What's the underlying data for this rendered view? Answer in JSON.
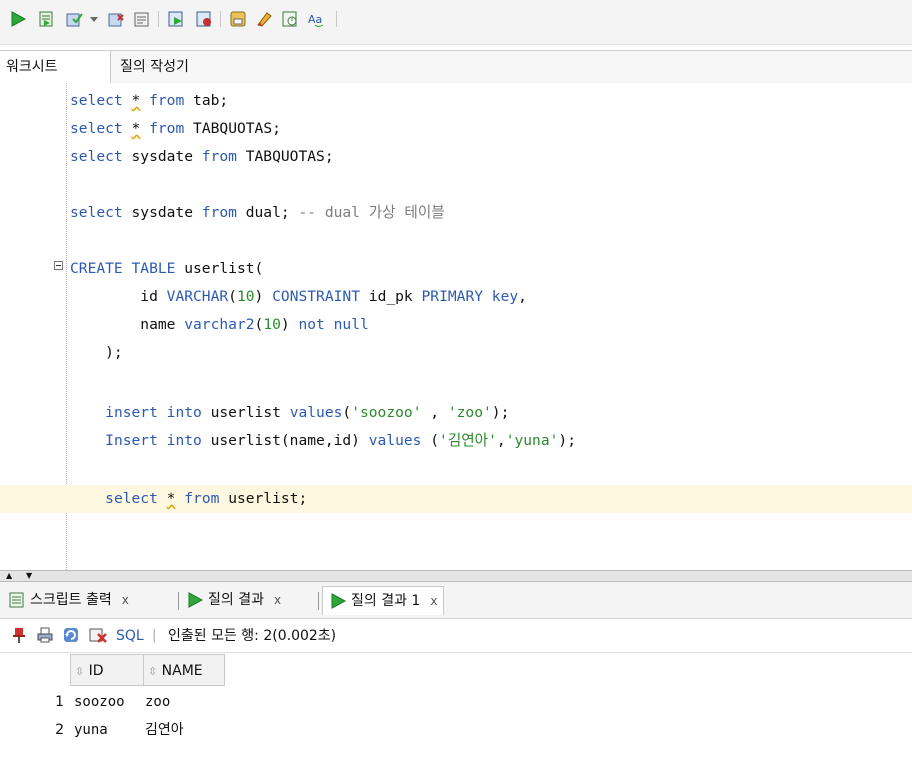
{
  "toolbar": {
    "icons": [
      "run-statement-icon",
      "run-script-icon",
      "commit-icon",
      "dropdown-icon",
      "rollback-icon",
      "explain-plan-icon",
      "autotrace-icon",
      "sql-tuning-icon",
      "clear-icon",
      "history-icon",
      "unshared-sql-icon",
      "format-icon"
    ]
  },
  "editor_tabs": [
    "워크시트",
    "질의 작성기"
  ],
  "code_lines": [
    {
      "text": "select * from tab;"
    },
    {
      "text": "select * from TABQUOTAS;"
    },
    {
      "text": "select sysdate from TABQUOTAS;"
    },
    {
      "text": ""
    },
    {
      "text": "select sysdate from dual; -- dual 가상 테이블"
    },
    {
      "text": ""
    },
    {
      "text": "CREATE TABLE userlist("
    },
    {
      "text": "        id VARCHAR(10) CONSTRAINT id_pk PRIMARY key,"
    },
    {
      "text": "        name varchar2(10) not null"
    },
    {
      "text": "    );"
    },
    {
      "text": ""
    },
    {
      "text": "    insert into userlist values('soozoo' , 'zoo');"
    },
    {
      "text": "    Insert into userlist(name,id) values ('김연아','yuna');"
    },
    {
      "text": ""
    },
    {
      "text": "    select * from userlist;"
    }
  ],
  "result_tabs": [
    {
      "label": "스크립트 출력",
      "close": "x",
      "icon": "script-output-icon"
    },
    {
      "label": "질의 결과",
      "close": "x",
      "icon": "query-result-icon"
    },
    {
      "label": "질의 결과 1",
      "close": "x",
      "icon": "query-result-icon"
    }
  ],
  "result_toolbar": {
    "sql_label": "SQL",
    "separator": "|",
    "status": "인출된 모든 행: 2(0.002초)"
  },
  "grid": {
    "columns": [
      "ID",
      "NAME"
    ],
    "rows": [
      {
        "num": "1",
        "id": "soozoo",
        "name": "zoo"
      },
      {
        "num": "2",
        "id": "yuna",
        "name": "김연아"
      }
    ]
  },
  "colors": {
    "keyword": "#2c5ab3",
    "string": "#2b8a2b",
    "comment": "#7c7c7c",
    "highlight": "#fff8e0"
  }
}
